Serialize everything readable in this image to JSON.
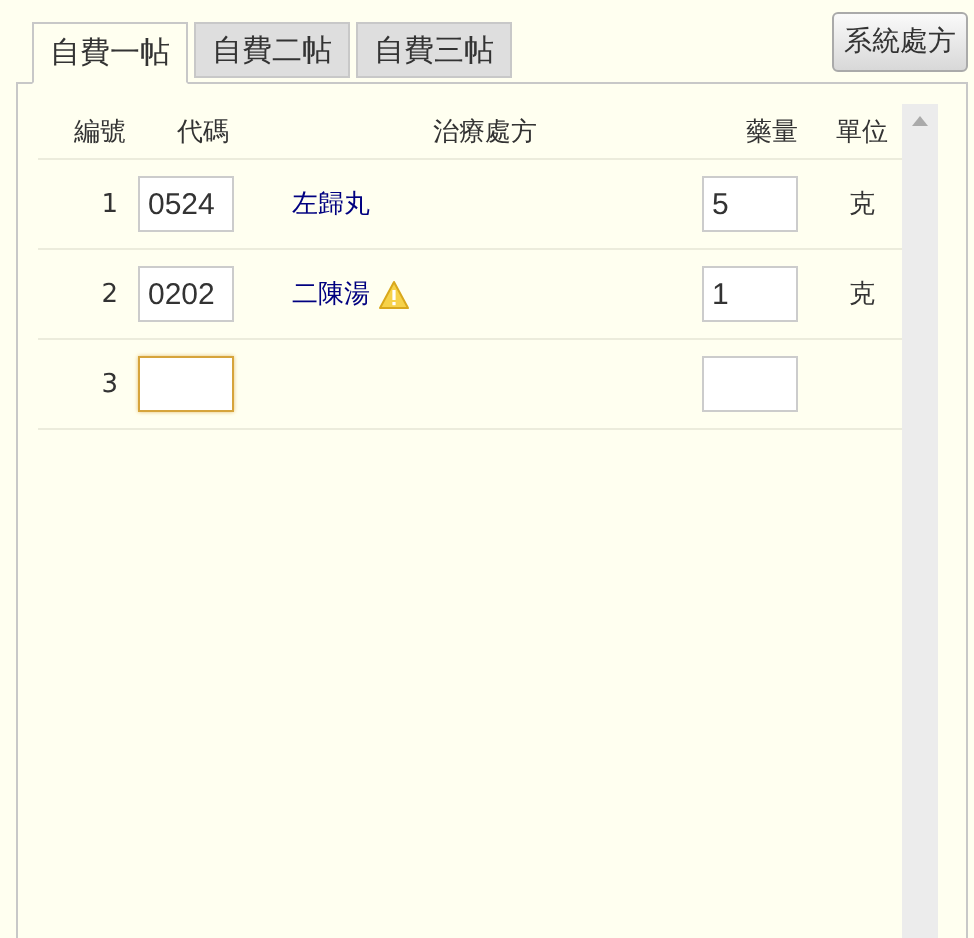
{
  "tabs": [
    {
      "label": "自費一帖",
      "selected": true
    },
    {
      "label": "自費二帖",
      "selected": false
    },
    {
      "label": "自費三帖",
      "selected": false
    }
  ],
  "system_button": "系統處方",
  "table": {
    "columns": [
      "編號",
      "代碼",
      "治療處方",
      "藥量",
      "單位"
    ],
    "rows": [
      {
        "number": "1",
        "code": "0524",
        "name": "左歸丸",
        "warning": false,
        "dose": "5",
        "unit": "克",
        "focused": false
      },
      {
        "number": "2",
        "code": "0202",
        "name": "二陳湯",
        "warning": true,
        "dose": "1",
        "unit": "克",
        "focused": false
      },
      {
        "number": "3",
        "focused": true
      }
    ]
  }
}
